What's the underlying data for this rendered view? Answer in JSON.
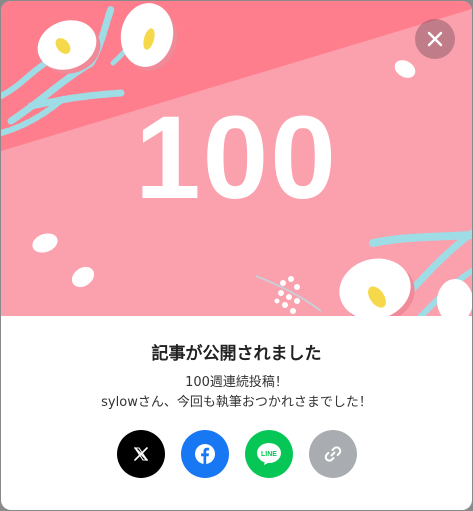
{
  "banner": {
    "number": "100",
    "colors": {
      "pink_light": "#fba0ad",
      "pink_dark": "#ff7e8e",
      "flower": "#ffffff",
      "stem": "#9fdde6",
      "stamen": "#f6d94a"
    }
  },
  "close_button": {
    "icon": "close-icon"
  },
  "dialog": {
    "title": "記事が公開されました",
    "message_line1": "100週連続投稿！",
    "message_line2": "sylowさん、今回も執筆おつかれさまでした！"
  },
  "share": {
    "buttons": [
      {
        "icon": "x-logo-icon",
        "color": "#000000"
      },
      {
        "icon": "facebook-logo-icon",
        "color": "#1877f2"
      },
      {
        "icon": "line-logo-icon",
        "color": "#06c755",
        "label": "LINE"
      },
      {
        "icon": "link-icon",
        "color": "#a9acb0"
      }
    ]
  }
}
